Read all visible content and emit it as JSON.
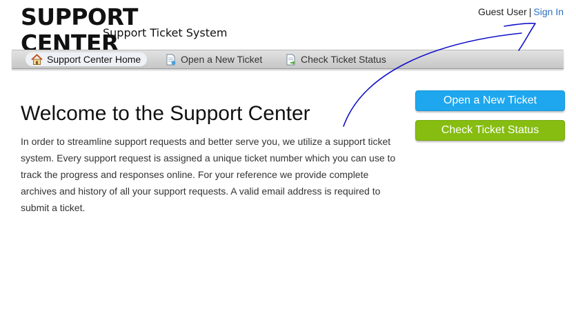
{
  "header": {
    "logo_title": "SUPPORT CENTER",
    "logo_subtitle": "Support Ticket System",
    "guest_label": "Guest User",
    "separator": "|",
    "sign_in_label": "Sign In"
  },
  "nav": {
    "items": [
      {
        "label": "Support Center Home",
        "icon": "home-icon",
        "active": true
      },
      {
        "label": "Open a New Ticket",
        "icon": "new-ticket-icon",
        "active": false
      },
      {
        "label": "Check Ticket Status",
        "icon": "ticket-status-icon",
        "active": false
      }
    ]
  },
  "main": {
    "heading": "Welcome to the Support Center",
    "intro": "In order to streamline support requests and better serve you, we utilize a support ticket system. Every support request is assigned a unique ticket number which you can use to track the progress and responses online. For your reference we provide complete archives and history of all your support requests. A valid email address is required to submit a ticket."
  },
  "sidebar": {
    "open_ticket_label": "Open a New Ticket",
    "check_status_label": "Check Ticket Status"
  },
  "colors": {
    "blue_button": "#1ea7ee",
    "green_button": "#86bd10",
    "link": "#2a6fc2",
    "annotation": "#1010c8"
  }
}
